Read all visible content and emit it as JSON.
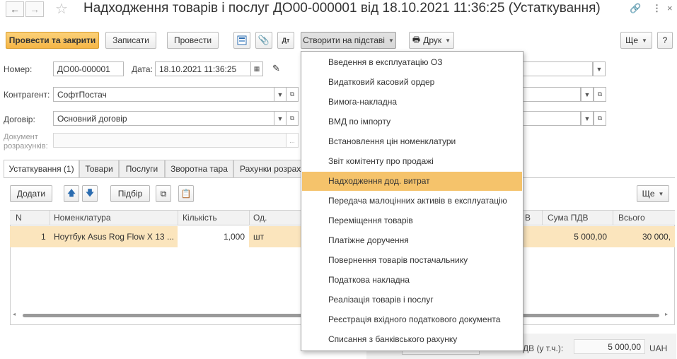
{
  "window": {
    "title": "Надходження товарів і послуг ДО00-000001 від 18.10.2021 11:36:25 (Устаткування)"
  },
  "toolbar": {
    "post_close": "Провести та закрити",
    "save": "Записати",
    "post": "Провести",
    "create_based": "Створити на підставі",
    "print": "Друк",
    "more": "Ще",
    "help": "?"
  },
  "form": {
    "number_label": "Номер:",
    "number_value": "ДО00-000001",
    "date_label": "Дата:",
    "date_value": "18.10.2021 11:36:25",
    "counterparty_label": "Контрагент:",
    "counterparty_value": "СофтПостач",
    "contract_label": "Договір:",
    "contract_value": "Основний договір",
    "settlement_label_1": "Документ",
    "settlement_label_2": "розрахунків:",
    "settlement_btn": "..."
  },
  "tabs": [
    "Устаткування (1)",
    "Товари",
    "Послуги",
    "Зворотна тара",
    "Рахунки розраху"
  ],
  "table_toolbar": {
    "add": "Додати",
    "pick": "Підбір",
    "more": "Ще"
  },
  "table": {
    "headers": [
      "N",
      "Номенклатура",
      "Кількість",
      "Од.",
      "В",
      "Сума ПДВ",
      "Всього"
    ],
    "rows": [
      {
        "n": "1",
        "item": "Ноутбук Asus Rog Flow X 13 ...",
        "qty": "1,000",
        "unit": "шт",
        "vat": "5 000,00",
        "total": "30 000,"
      }
    ]
  },
  "footer": {
    "vat_label": "ДВ (у т.ч.):",
    "vat_value": "5 000,00",
    "currency": "UAH"
  },
  "menu": {
    "items": [
      "Введення в експлуатацію ОЗ",
      "Видатковий касовий ордер",
      "Вимога-накладна",
      "ВМД по імпорту",
      "Встановлення цін номенклатури",
      "Звіт комітенту про продажі",
      "Надходження дод. витрат",
      "Передача малоцінних активів в експлуатацію",
      "Переміщення товарів",
      "Платіжне доручення",
      "Повернення товарів постачальнику",
      "Податкова накладна",
      "Реалізація товарів і послуг",
      "Реєстрація вхідного податкового документа",
      "Списання з банківського рахунку"
    ],
    "highlighted_index": 6
  },
  "colors": {
    "primary_button": "#f5b545",
    "selected_row": "#fbe5bd",
    "menu_highlight": "#f5c36b"
  }
}
